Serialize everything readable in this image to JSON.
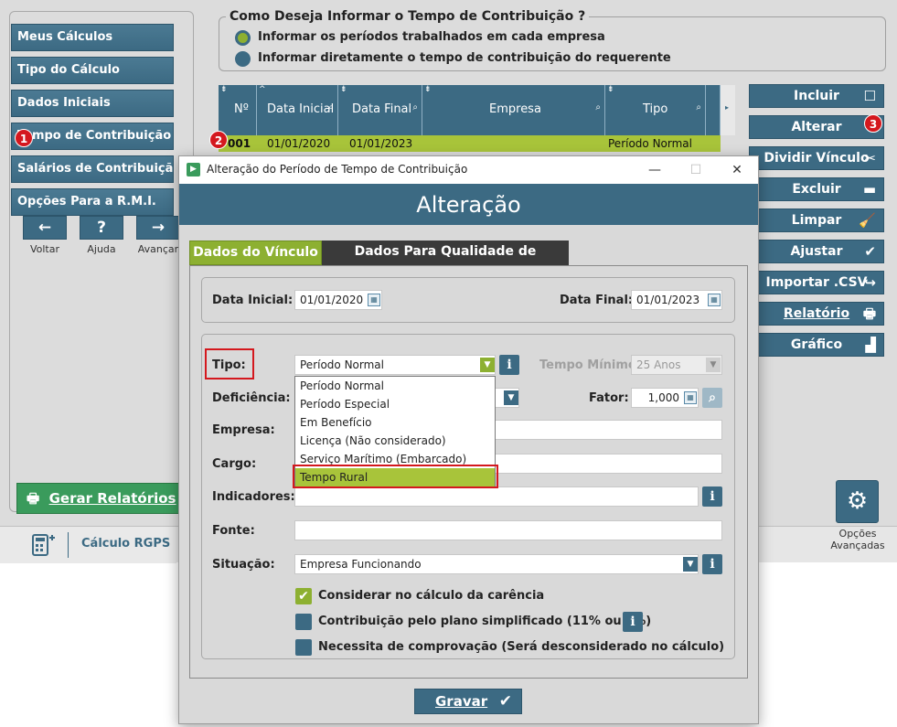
{
  "nav": {
    "items": [
      {
        "label": "Meus Cálculos"
      },
      {
        "label": "Tipo do Cálculo"
      },
      {
        "label": "Dados Iniciais"
      },
      {
        "label": "Tempo de Contribuição"
      },
      {
        "label": "Salários de Contribuição"
      },
      {
        "label": "Opções Para a R.M.I."
      }
    ],
    "back_label": "Voltar",
    "help_label": "Ajuda",
    "forward_label": "Avançar",
    "generate_label": "Gerar Relatórios",
    "calc_tab_label": "Cálculo RGPS"
  },
  "markers": {
    "m1": "1",
    "m2": "2",
    "m3": "3"
  },
  "contribution_mode": {
    "title": "Como Deseja Informar o Tempo de Contribuição ?",
    "option_periods": "Informar os períodos trabalhados em cada empresa",
    "option_direct": "Informar diretamente o tempo de contribuição do requerente"
  },
  "grid": {
    "columns": [
      "Nº",
      "Data Inicial",
      "Data Final",
      "Empresa",
      "Tipo"
    ],
    "row": {
      "num": "001",
      "start": "01/01/2020",
      "end": "01/01/2023",
      "company": "",
      "type": "Período Normal"
    }
  },
  "actions": {
    "incluir": "Incluir",
    "alterar": "Alterar",
    "dividir": "Dividir Vínculo",
    "excluir": "Excluir",
    "limpar": "Limpar",
    "ajustar": "Ajustar",
    "importar": "Importar .CSV",
    "relatorio": "Relatório",
    "grafico": "Gráfico"
  },
  "advanced": {
    "label_line1": "Opções",
    "label_line2": "Avançadas"
  },
  "dialog": {
    "title": "Alteração do Período de Tempo de Contribuição",
    "header": "Alteração",
    "tabs": {
      "vinculo": "Dados do Vínculo",
      "qualidade": "Dados Para Qualidade de Segurado"
    },
    "labels": {
      "data_inicial": "Data Inicial:",
      "data_final": "Data Final:",
      "tipo": "Tipo:",
      "tempo_minimo": "Tempo Mínimo:",
      "deficiencia": "Deficiência:",
      "fator": "Fator:",
      "empresa": "Empresa:",
      "cargo": "Cargo:",
      "indicadores": "Indicadores:",
      "fonte": "Fonte:",
      "situacao": "Situação:"
    },
    "values": {
      "data_inicial": "01/01/2020",
      "data_final": "01/01/2023",
      "tipo": "Período Normal",
      "tempo_minimo": "25 Anos",
      "fator": "1,000",
      "situacao": "Empresa Funcionando"
    },
    "tipo_options": [
      "Período Normal",
      "Período Especial",
      "Em Benefício",
      "Licença (Não considerado)",
      "Serviço Marítimo (Embarcado)",
      "Tempo Rural"
    ],
    "checks": {
      "carencia": "Considerar no cálculo da carência",
      "simplificado": "Contribuição pelo plano simplificado (11% ou 5%)",
      "comprovacao": "Necessita de comprovação (Será desconsiderado no cálculo)"
    },
    "save_label": "Gravar"
  }
}
